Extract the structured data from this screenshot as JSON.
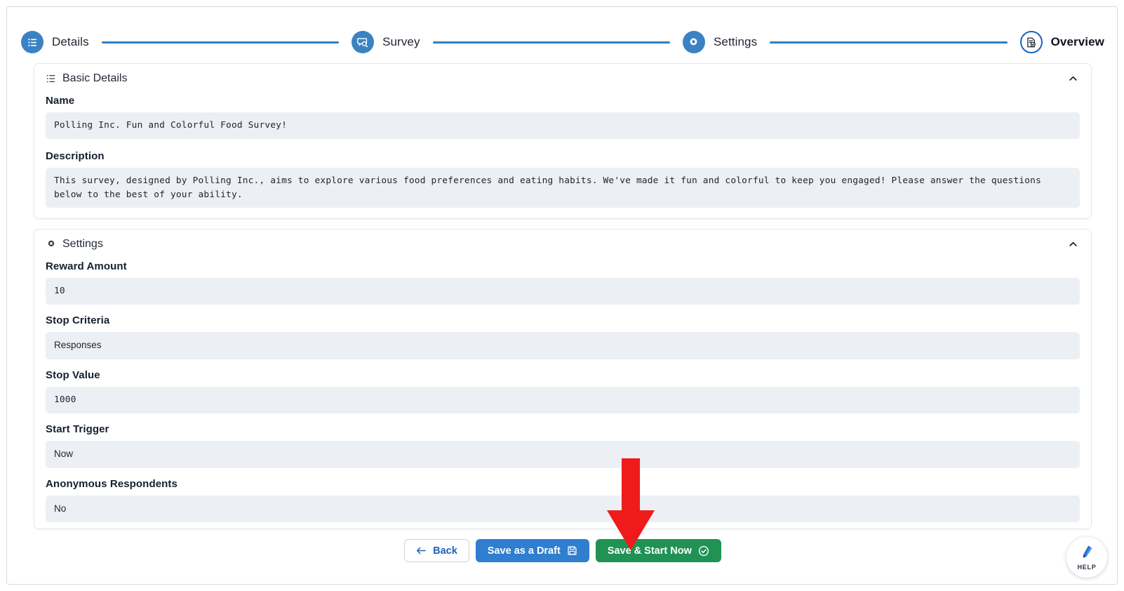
{
  "stepper": {
    "steps": [
      {
        "label": "Details",
        "icon": "list-icon",
        "state": "done"
      },
      {
        "label": "Survey",
        "icon": "survey-search-icon",
        "state": "done"
      },
      {
        "label": "Settings",
        "icon": "gear-icon",
        "state": "done"
      },
      {
        "label": "Overview",
        "icon": "document-check-icon",
        "state": "current"
      }
    ],
    "accent_done": "#3b82c2",
    "accent_current": "#1565c0",
    "connector_color": "#2f7fc1"
  },
  "basic_details": {
    "section_title": "Basic Details",
    "section_icon": "bullet-list-icon",
    "collapse_icon": "chevron-up-icon",
    "fields": [
      {
        "label": "Name",
        "value": "Polling Inc. Fun and Colorful Food Survey!"
      },
      {
        "label": "Description",
        "value": "This survey, designed by Polling Inc., aims to explore various food preferences and eating habits. We've made it fun and colorful to keep you engaged! Please answer the questions below to the best of your ability."
      }
    ]
  },
  "settings": {
    "section_title": "Settings",
    "section_icon": "gear-icon",
    "collapse_icon": "chevron-up-icon",
    "fields": [
      {
        "label": "Reward Amount",
        "value": "10",
        "style": "mono"
      },
      {
        "label": "Stop Criteria",
        "value": "Responses",
        "style": "sans"
      },
      {
        "label": "Stop Value",
        "value": "1000",
        "style": "mono"
      },
      {
        "label": "Start Trigger",
        "value": "Now",
        "style": "sans"
      },
      {
        "label": "Anonymous Respondents",
        "value": "No",
        "style": "sans"
      }
    ]
  },
  "footer": {
    "back_label": "Back",
    "back_icon": "arrow-left-icon",
    "draft_label": "Save as a Draft",
    "draft_icon": "floppy-disk-icon",
    "start_label": "Save & Start Now",
    "start_icon": "check-circle-icon",
    "draft_color": "#2f7ed0",
    "start_color": "#1f9254"
  },
  "help_widget": {
    "label": "HELP",
    "icon": "pen-icon"
  },
  "annotation": {
    "type": "arrow-down",
    "color": "#ef1b1b",
    "points_to": "Save & Start Now"
  }
}
